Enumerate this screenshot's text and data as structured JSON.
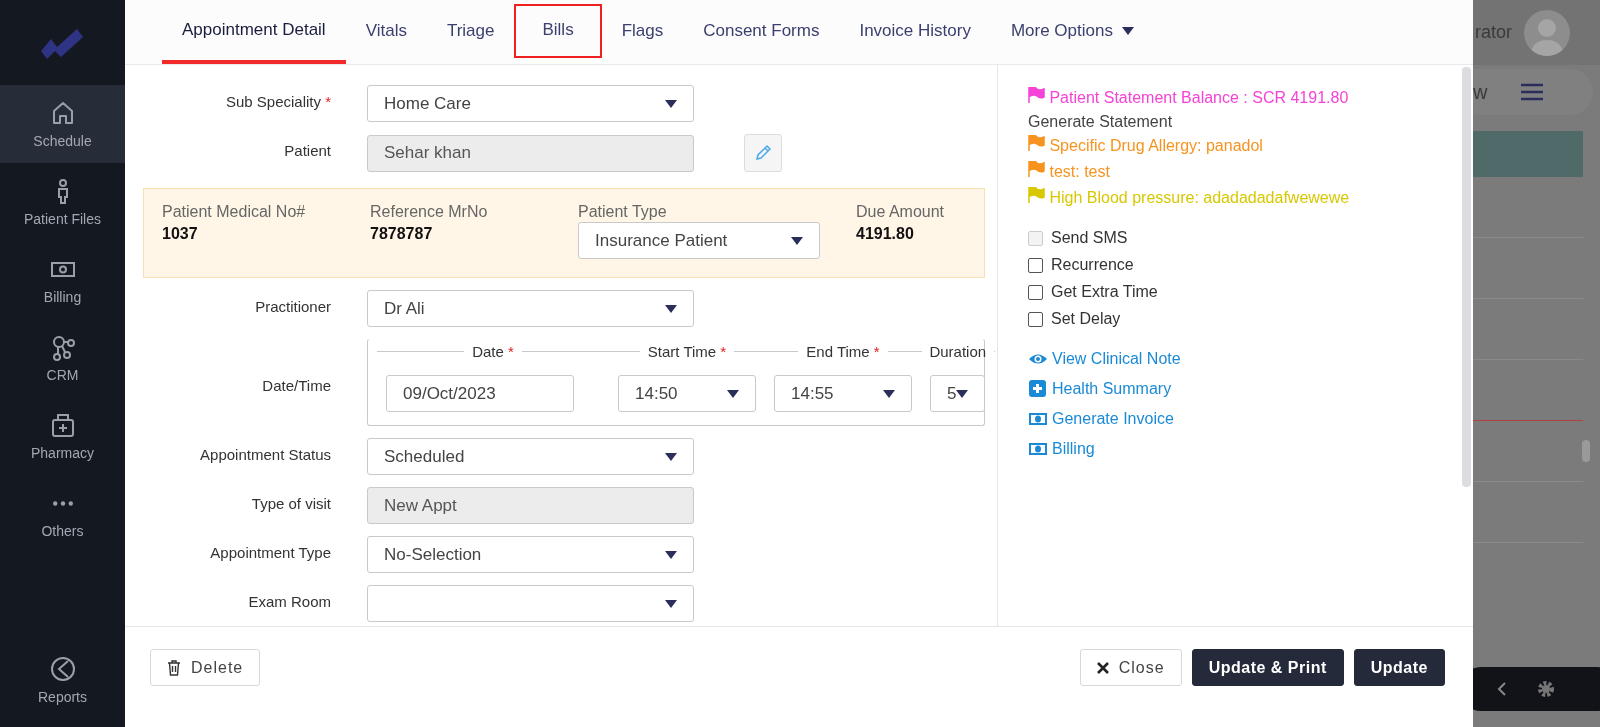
{
  "sidebar": {
    "items": [
      {
        "label": "Schedule",
        "kind": "home",
        "selected": true
      },
      {
        "label": "Patient Files",
        "kind": "person",
        "selected": false
      },
      {
        "label": "Billing",
        "kind": "money",
        "selected": false
      },
      {
        "label": "CRM",
        "kind": "nodes",
        "selected": false
      },
      {
        "label": "Pharmacy",
        "kind": "kit",
        "selected": false
      },
      {
        "label": "Others",
        "kind": "dots",
        "selected": false
      }
    ],
    "bottom_item": {
      "label": "Reports",
      "kind": "pie",
      "selected": false
    }
  },
  "background": {
    "user_name": "rator",
    "view_label": "w"
  },
  "modal": {
    "tabs": [
      {
        "label": "Appointment Detail",
        "selected": true,
        "highlighted": false
      },
      {
        "label": "Vitals",
        "selected": false,
        "highlighted": false
      },
      {
        "label": "Triage",
        "selected": false,
        "highlighted": false
      },
      {
        "label": "Bills",
        "selected": false,
        "highlighted": true
      },
      {
        "label": "Flags",
        "selected": false,
        "highlighted": false
      },
      {
        "label": "Consent Forms",
        "selected": false,
        "highlighted": false
      },
      {
        "label": "Invoice History",
        "selected": false,
        "highlighted": false
      },
      {
        "label": "More Options",
        "selected": false,
        "highlighted": false,
        "kind": "dropdown"
      }
    ],
    "form": [
      {
        "kind": "select",
        "label": "Sub Speciality",
        "required_mark": "*",
        "value": "Home Care"
      },
      {
        "kind": "readonly",
        "label": "Patient",
        "value": "Sehar khan",
        "edit_button": true
      },
      {
        "kind": "info",
        "items": [
          {
            "label": "Patient Medical No#",
            "value": "1037"
          },
          {
            "label": "Reference MrNo",
            "value": "7878787"
          },
          {
            "label": "Patient Type",
            "select": "Insurance Patient"
          },
          {
            "label": "Due Amount",
            "value": "4191.80"
          }
        ]
      },
      {
        "kind": "select",
        "label": "Practitioner",
        "value": "Dr Ali"
      },
      {
        "kind": "datetime",
        "label": "Date/Time",
        "parts": [
          {
            "label": "Date",
            "required_mark": "*",
            "kind": "input",
            "value": "09/Oct/2023"
          },
          {
            "label": "Start Time",
            "required_mark": "*",
            "kind": "select",
            "value": "14:50"
          },
          {
            "label": "End Time",
            "required_mark": "*",
            "kind": "select",
            "value": "14:55"
          },
          {
            "label": "Duration",
            "kind": "select",
            "value": "5"
          }
        ]
      },
      {
        "kind": "select",
        "label": "Appointment Status",
        "value": "Scheduled"
      },
      {
        "kind": "readonly",
        "label": "Type of visit",
        "value": "New Appt"
      },
      {
        "kind": "select",
        "label": "Appointment Type",
        "value": "No-Selection"
      },
      {
        "kind": "select",
        "label": "Exam Room"
      }
    ],
    "flags": [
      {
        "kind": "flag",
        "text": "Patient Statement Balance : SCR 4191.80",
        "color": "#f542d7"
      },
      {
        "kind": "plain",
        "text": "Generate Statement"
      },
      {
        "kind": "flag",
        "text": "Specific Drug Allergy: panadol",
        "color": "#f7931e"
      },
      {
        "kind": "flag",
        "text": "test: test",
        "color": "#f7931e"
      },
      {
        "kind": "flag",
        "text": "High Blood pressure: adadadadafwewewe",
        "color": "#d8c800"
      }
    ],
    "options": [
      {
        "label": "Send SMS",
        "checked": false,
        "disabled": true
      },
      {
        "label": "Recurrence",
        "checked": false,
        "disabled": false
      },
      {
        "label": "Get Extra Time",
        "checked": false,
        "disabled": false
      },
      {
        "label": "Set Delay",
        "checked": false,
        "disabled": false
      }
    ],
    "links": [
      {
        "label": "View Clinical Note",
        "kind": "eye"
      },
      {
        "label": "Health Summary",
        "kind": "plus"
      },
      {
        "label": "Generate Invoice",
        "kind": "money"
      },
      {
        "label": "Billing",
        "kind": "money"
      }
    ],
    "footer": [
      {
        "label": "Delete",
        "kind": "delete"
      },
      {
        "label": "Close",
        "kind": "close"
      },
      {
        "label": "Update & Print",
        "kind": "primary"
      },
      {
        "label": "Update",
        "kind": "primary"
      }
    ]
  }
}
